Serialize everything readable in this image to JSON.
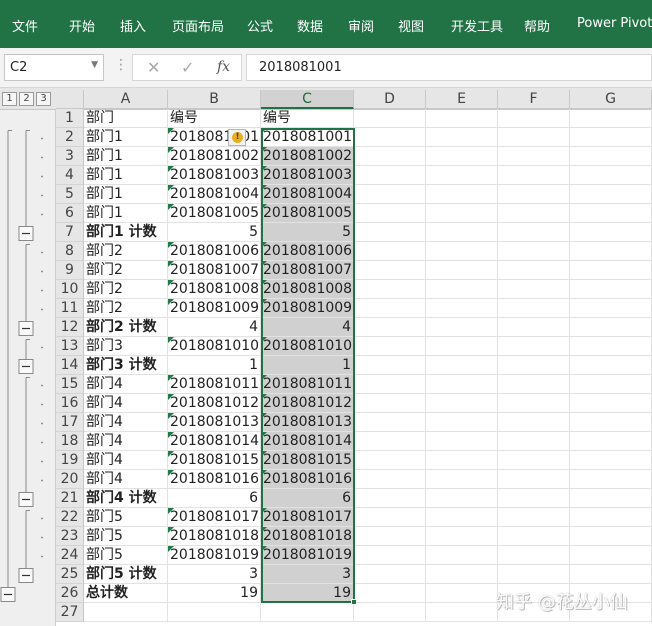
{
  "ribbon": {
    "tabs": [
      "文件",
      "开始",
      "插入",
      "页面布局",
      "公式",
      "数据",
      "审阅",
      "视图",
      "开发工具",
      "帮助",
      "Power Pivot"
    ]
  },
  "formula_bar": {
    "name_box": "C2",
    "cancel_icon": "✕",
    "enter_icon": "✓",
    "fx_label": "fx",
    "content": "2018081001"
  },
  "outline_levels": [
    "1",
    "2",
    "3"
  ],
  "columns": [
    "A",
    "B",
    "C",
    "D",
    "E",
    "F",
    "G"
  ],
  "rows": [
    {
      "n": "1",
      "a": "部门",
      "b": "编号",
      "c": "编号"
    },
    {
      "n": "2",
      "a": "部门1",
      "b": "2018081001",
      "c": "2018081001"
    },
    {
      "n": "3",
      "a": "部门1",
      "b": "2018081002",
      "c": "2018081002"
    },
    {
      "n": "4",
      "a": "部门1",
      "b": "2018081003",
      "c": "2018081003"
    },
    {
      "n": "5",
      "a": "部门1",
      "b": "2018081004",
      "c": "2018081004"
    },
    {
      "n": "6",
      "a": "部门1",
      "b": "2018081005",
      "c": "2018081005"
    },
    {
      "n": "7",
      "a": "部门1 计数",
      "b": "5",
      "c": "5",
      "sub": true
    },
    {
      "n": "8",
      "a": "部门2",
      "b": "2018081006",
      "c": "2018081006"
    },
    {
      "n": "9",
      "a": "部门2",
      "b": "2018081007",
      "c": "2018081007"
    },
    {
      "n": "10",
      "a": "部门2",
      "b": "2018081008",
      "c": "2018081008"
    },
    {
      "n": "11",
      "a": "部门2",
      "b": "2018081009",
      "c": "2018081009"
    },
    {
      "n": "12",
      "a": "部门2 计数",
      "b": "4",
      "c": "4",
      "sub": true
    },
    {
      "n": "13",
      "a": "部门3",
      "b": "2018081010",
      "c": "2018081010"
    },
    {
      "n": "14",
      "a": "部门3 计数",
      "b": "1",
      "c": "1",
      "sub": true
    },
    {
      "n": "15",
      "a": "部门4",
      "b": "2018081011",
      "c": "2018081011"
    },
    {
      "n": "16",
      "a": "部门4",
      "b": "2018081012",
      "c": "2018081012"
    },
    {
      "n": "17",
      "a": "部门4",
      "b": "2018081013",
      "c": "2018081013"
    },
    {
      "n": "18",
      "a": "部门4",
      "b": "2018081014",
      "c": "2018081014"
    },
    {
      "n": "19",
      "a": "部门4",
      "b": "2018081015",
      "c": "2018081015"
    },
    {
      "n": "20",
      "a": "部门4",
      "b": "2018081016",
      "c": "2018081016"
    },
    {
      "n": "21",
      "a": "部门4 计数",
      "b": "6",
      "c": "6",
      "sub": true
    },
    {
      "n": "22",
      "a": "部门5",
      "b": "2018081017",
      "c": "2018081017"
    },
    {
      "n": "23",
      "a": "部门5",
      "b": "2018081018",
      "c": "2018081018"
    },
    {
      "n": "24",
      "a": "部门5",
      "b": "2018081019",
      "c": "2018081019"
    },
    {
      "n": "25",
      "a": "部门5 计数",
      "b": "3",
      "c": "3",
      "sub": true
    },
    {
      "n": "26",
      "a": "总计数",
      "b": "19",
      "c": "19",
      "sub": true
    },
    {
      "n": "27",
      "a": "",
      "b": "",
      "c": ""
    }
  ],
  "watermark": "知乎 @花丛小仙",
  "warning_icon": "!",
  "colors": {
    "ribbon": "#217346",
    "selection": "#217346",
    "selected_fill": "#d0d0d0"
  }
}
